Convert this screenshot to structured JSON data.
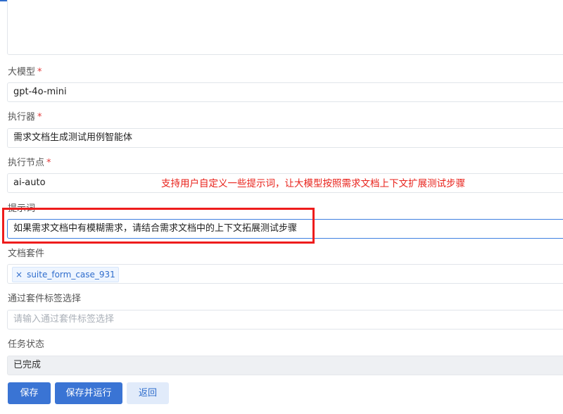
{
  "form": {
    "description_value": "",
    "model": {
      "label": "大模型",
      "required_mark": "*",
      "value": "gpt-4o-mini"
    },
    "executor": {
      "label": "执行器",
      "required_mark": "*",
      "value": "需求文档生成测试用例智能体"
    },
    "node": {
      "label": "执行节点",
      "required_mark": "*",
      "value": "ai-auto"
    },
    "prompt": {
      "label": "提示词",
      "value": "如果需求文档中有模糊需求，请结合需求文档中的上下文拓展测试步骤"
    },
    "suite": {
      "label": "文档套件",
      "tags": [
        {
          "remove": "×",
          "text": "suite_form_case_931"
        }
      ]
    },
    "suite_tag": {
      "label": "通过套件标签选择",
      "placeholder": "请输入通过套件标签选择"
    },
    "status": {
      "label": "任务状态",
      "value": "已完成"
    }
  },
  "annotation": {
    "text": "支持用户自定义一些提示词，让大模型按照需求文档上下文扩展测试步骤",
    "color": "#e8221b"
  },
  "buttons": {
    "save": "保存",
    "save_run": "保存并运行",
    "back": "返回"
  },
  "colors": {
    "primary": "#3a74d4",
    "required": "#e23b3b",
    "highlight_box": "#ee1c1c"
  }
}
